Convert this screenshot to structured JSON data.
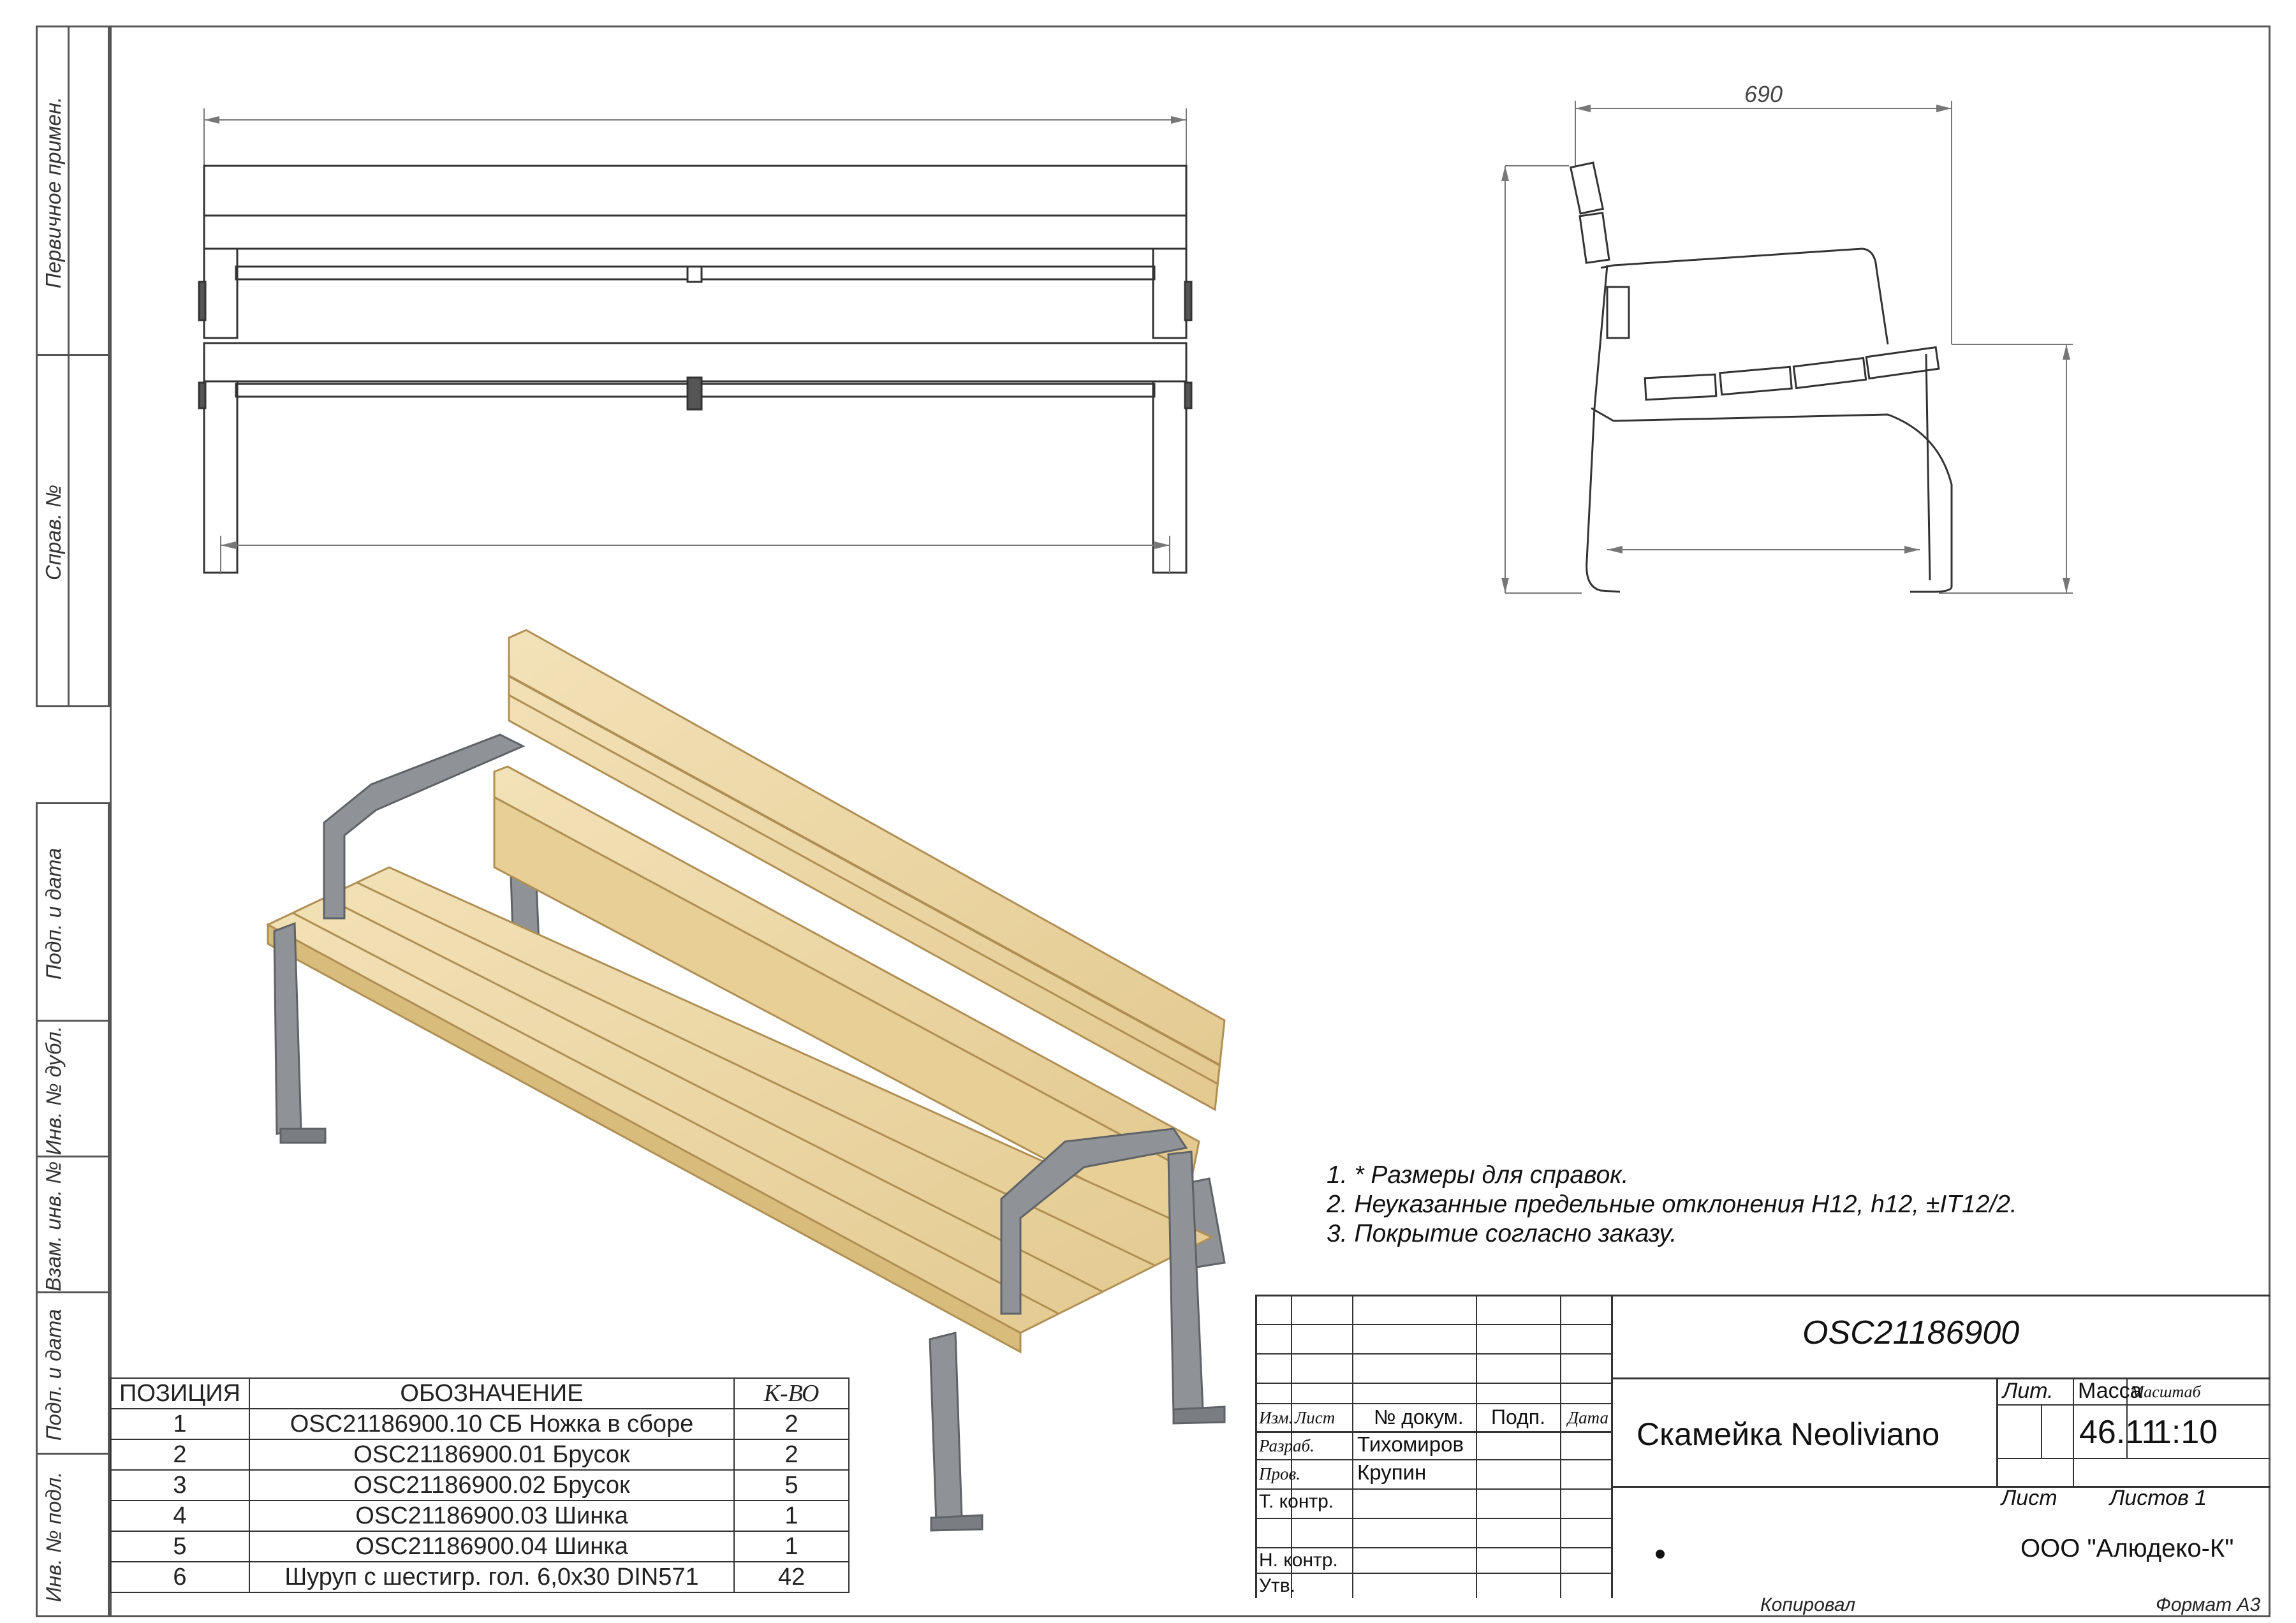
{
  "side_stamp": [
    {
      "label": "Первичное примен."
    },
    {
      "label": "Справ. №"
    },
    {
      "label": "Подп. и дата"
    },
    {
      "label": "Инв. № дубл."
    },
    {
      "label": "Взам. инв. №"
    },
    {
      "label": "Подп. и дата"
    },
    {
      "label": "Инв. № подл."
    }
  ],
  "dimensions": {
    "side_width": "690"
  },
  "notes": [
    "1. * Размеры для справок.",
    "2. Неуказанные предельные отклонения H12, h12,  ±IT12/2.",
    "3. Покрытие согласно заказу."
  ],
  "spec_table": {
    "headers": [
      "ПОЗИЦИЯ",
      "ОБОЗНАЧЕНИЕ",
      "К-ВО"
    ],
    "rows": [
      [
        "1",
        "OSC21186900.10 СБ Ножка в сборе",
        "2"
      ],
      [
        "2",
        "OSC21186900.01 Брусок",
        "2"
      ],
      [
        "3",
        "OSC21186900.02 Брусок",
        "5"
      ],
      [
        "4",
        "OSC21186900.03 Шинка",
        "1"
      ],
      [
        "5",
        "OSC21186900.04 Шинка",
        "1"
      ],
      [
        "6",
        "Шуруп с шестигр. гол. 6,0х30 DIN571",
        "42"
      ]
    ]
  },
  "title_block": {
    "doc_number": "OSC21186900",
    "name": "Скамейка Neoliviano",
    "lit_label": "Лит.",
    "mass_label": "Масса",
    "scale_label": "Масштаб",
    "mass": "46.11",
    "scale": "1:10",
    "sheet_label": "Лист",
    "sheets_label": "Листов 1",
    "company": "ООО \"Алюдеко-К\"",
    "cols": {
      "izm": "Изм.",
      "list": "Лист",
      "doc": "№ докум.",
      "sign": "Подп.",
      "date": "Дата"
    },
    "roles": {
      "developer_label": "Разраб.",
      "developer": "Тихомиров",
      "checker_label": "Пров.",
      "checker": "Крупин",
      "tcontrol_label": "Т. контр.",
      "ncontrol_label": "Н. контр.",
      "approve_label": "Утв."
    }
  },
  "footer": {
    "copied": "Копировал",
    "format": "Формат A3"
  },
  "colors": {
    "wood": "#ecd6a3",
    "wood_dark": "#c9ab6e",
    "metal": "#8f9296",
    "metal_dark": "#5f6266",
    "line": "#333333"
  }
}
